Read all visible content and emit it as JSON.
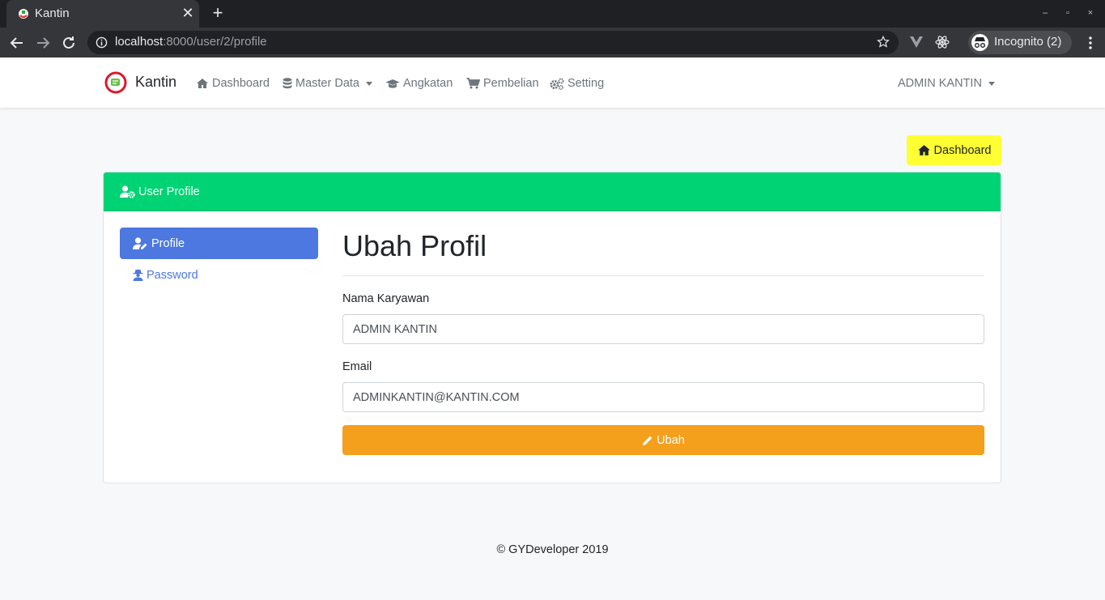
{
  "browser": {
    "tab_title": "Kantin",
    "url_host": "localhost",
    "url_path": ":8000/user/2/profile",
    "incognito_label": "Incognito (2)",
    "window_controls": [
      "–",
      "▫",
      "×"
    ]
  },
  "navbar": {
    "brand": "Kantin",
    "links": [
      {
        "label": "Dashboard",
        "icon": "home-icon"
      },
      {
        "label": "Master Data",
        "icon": "database-icon",
        "dropdown": true
      },
      {
        "label": "Angkatan",
        "icon": "graduation-cap-icon"
      },
      {
        "label": "Pembelian",
        "icon": "cart-icon"
      },
      {
        "label": "Setting",
        "icon": "cogs-icon"
      }
    ],
    "user_menu": "ADMIN KANTIN"
  },
  "top_button": {
    "label": "Dashboard",
    "icon": "home-icon",
    "color": "#ffff33"
  },
  "card": {
    "header": "User Profile",
    "header_color": "#00d374",
    "side_nav": [
      {
        "label": "Profile",
        "active": true,
        "icon": "user-edit-icon"
      },
      {
        "label": "Password",
        "active": false,
        "icon": "user-secret-icon"
      }
    ],
    "form": {
      "title": "Ubah Profil",
      "fields": [
        {
          "label": "Nama Karyawan",
          "value": "ADMIN KANTIN"
        },
        {
          "label": "Email",
          "value": "ADMINKANTIN@KANTIN.COM"
        }
      ],
      "submit_label": "Ubah",
      "submit_color": "#f4a01c"
    }
  },
  "footer": "© GYDeveloper 2019"
}
